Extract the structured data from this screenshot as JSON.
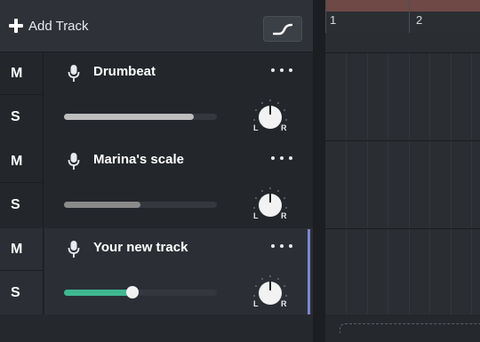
{
  "header": {
    "add_track_label": "Add Track",
    "automation_icon": "automation-curve-icon"
  },
  "tracks": [
    {
      "name": "Drumbeat",
      "mute_label": "M",
      "solo_label": "S",
      "volume": 0.85,
      "volume_color": "#bdbdbd",
      "pan": "center",
      "selected": false,
      "pan_left_label": "L",
      "pan_right_label": "R"
    },
    {
      "name": "Marina's scale",
      "mute_label": "M",
      "solo_label": "S",
      "volume": 0.5,
      "volume_color": "#8a8a8a",
      "pan": "center",
      "selected": false,
      "pan_left_label": "L",
      "pan_right_label": "R"
    },
    {
      "name": "Your new track",
      "mute_label": "M",
      "solo_label": "S",
      "volume": 0.45,
      "volume_color": "#3fb891",
      "pan": "center",
      "selected": true,
      "pan_left_label": "L",
      "pan_right_label": "R"
    }
  ],
  "ruler": {
    "bars": [
      "1",
      "2"
    ]
  },
  "colors": {
    "selection": "#7e86c8",
    "region": "#7a4d4a"
  }
}
